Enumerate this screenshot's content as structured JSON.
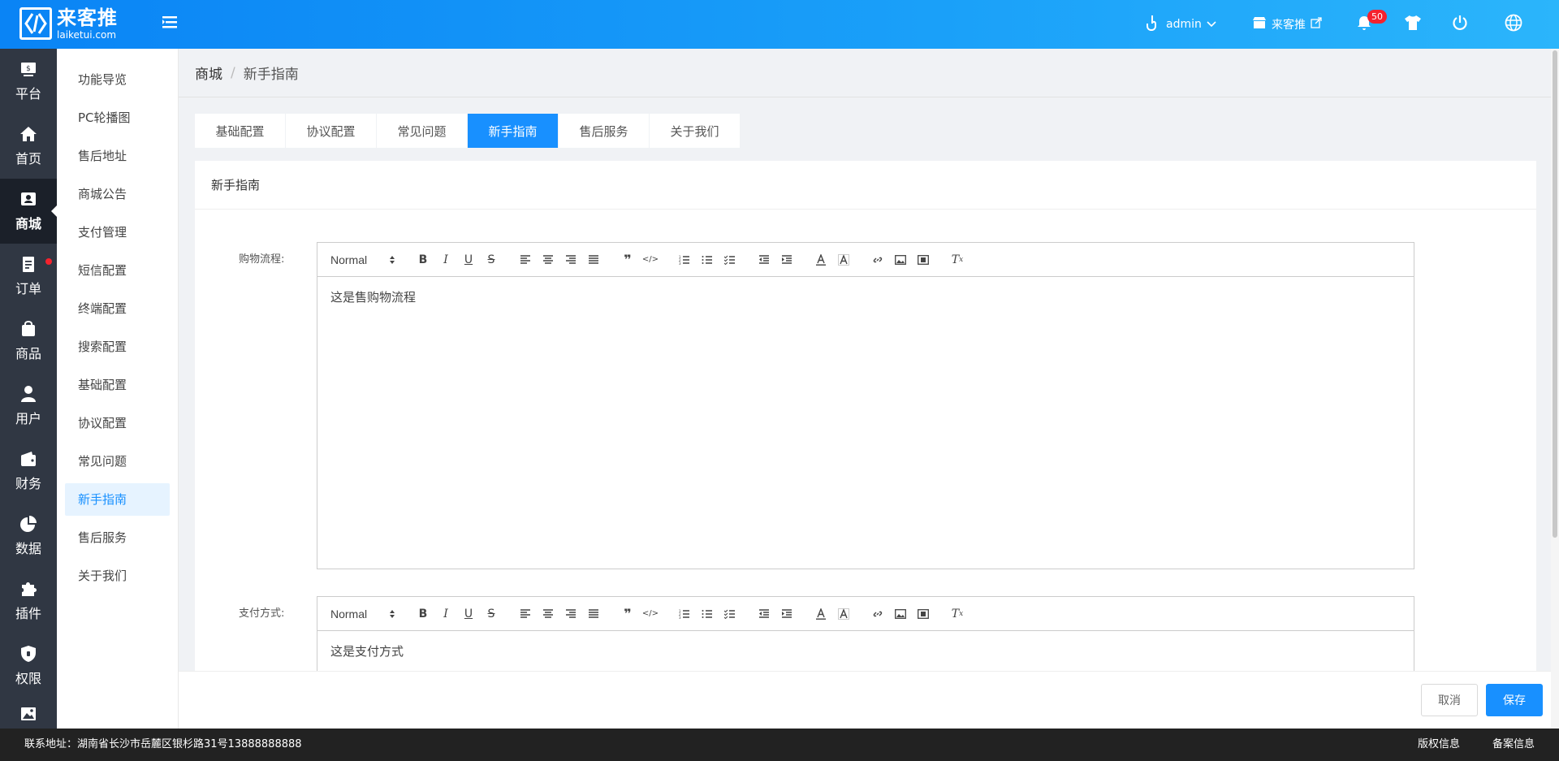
{
  "brand": {
    "name_cn": "来客推",
    "name_en": "laiketui.com"
  },
  "header": {
    "user": "admin",
    "store": "来客推",
    "notification_count": "50"
  },
  "leftnav": [
    {
      "label": "平台",
      "icon": "platform-icon"
    },
    {
      "label": "首页",
      "icon": "home-icon"
    },
    {
      "label": "商城",
      "icon": "mall-icon",
      "active": true
    },
    {
      "label": "订单",
      "icon": "order-icon",
      "dot": true
    },
    {
      "label": "商品",
      "icon": "goods-icon"
    },
    {
      "label": "用户",
      "icon": "user-icon"
    },
    {
      "label": "财务",
      "icon": "wallet-icon"
    },
    {
      "label": "数据",
      "icon": "pie-chart-icon"
    },
    {
      "label": "插件",
      "icon": "puzzle-icon"
    },
    {
      "label": "权限",
      "icon": "shield-icon"
    }
  ],
  "subnav": [
    "功能导览",
    "PC轮播图",
    "售后地址",
    "商城公告",
    "支付管理",
    "短信配置",
    "终端配置",
    "搜索配置",
    "基础配置",
    "协议配置",
    "常见问题",
    "新手指南",
    "售后服务",
    "关于我们"
  ],
  "subnav_active": "新手指南",
  "breadcrumb": {
    "root": "商城",
    "sep": "/",
    "current": "新手指南"
  },
  "tabs": [
    "基础配置",
    "协议配置",
    "常见问题",
    "新手指南",
    "售后服务",
    "关于我们"
  ],
  "tab_active": "新手指南",
  "card": {
    "title": "新手指南"
  },
  "fields": [
    {
      "label": "购物流程:",
      "format": "Normal",
      "content": "这是售购物流程"
    },
    {
      "label": "支付方式:",
      "format": "Normal",
      "content": "这是支付方式"
    }
  ],
  "actions": {
    "cancel": "取消",
    "save": "保存"
  },
  "footer": {
    "address": "联系地址：湖南省长沙市岳麓区银杉路31号13888888888",
    "copyright": "版权信息",
    "record": "备案信息"
  },
  "colors": {
    "primary": "#1890ff",
    "header_start": "#0a84f5",
    "header_end": "#2bb5fb",
    "nav_bg": "#303743"
  }
}
